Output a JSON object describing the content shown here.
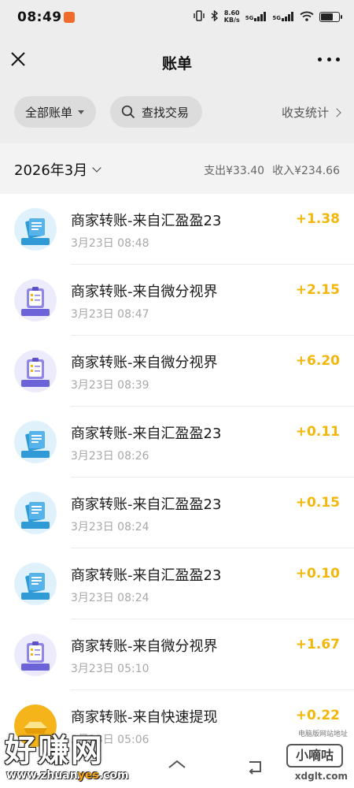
{
  "status_bar": {
    "time": "08:49",
    "net_speed_value": "8.60",
    "net_speed_unit": "KB/s",
    "sim1": "5G",
    "sim2": "5G"
  },
  "header": {
    "title": "账单"
  },
  "filters": {
    "all_bills": "全部账单",
    "search": "查找交易",
    "stats": "收支统计"
  },
  "month_summary": {
    "month": "2026年3月",
    "expense": "支出¥33.40",
    "income": "收入¥234.66"
  },
  "transactions": [
    {
      "title": "商家转账-来自汇盈盈23",
      "time": "3月23日 08:48",
      "amount": "+1.38",
      "icon": "ledger-book-icon"
    },
    {
      "title": "商家转账-来自微分视界",
      "time": "3月23日 08:47",
      "amount": "+2.15",
      "icon": "clipboard-icon"
    },
    {
      "title": "商家转账-来自微分视界",
      "time": "3月23日 08:39",
      "amount": "+6.20",
      "icon": "clipboard-icon"
    },
    {
      "title": "商家转账-来自汇盈盈23",
      "time": "3月23日 08:26",
      "amount": "+0.11",
      "icon": "ledger-book-icon"
    },
    {
      "title": "商家转账-来自汇盈盈23",
      "time": "3月23日 08:24",
      "amount": "+0.15",
      "icon": "ledger-book-icon"
    },
    {
      "title": "商家转账-来自汇盈盈23",
      "time": "3月23日 08:24",
      "amount": "+0.10",
      "icon": "ledger-book-icon"
    },
    {
      "title": "商家转账-来自微分视界",
      "time": "3月23日 05:10",
      "amount": "+1.67",
      "icon": "clipboard-icon"
    },
    {
      "title": "商家转账-来自快速提现",
      "time": "3月23日 05:06",
      "amount": "+0.22",
      "icon": "gold-ingot-icon"
    }
  ],
  "watermark": {
    "left_text": "好赚网",
    "left_url_a": "www.zhuan",
    "left_url_b": "yes",
    "left_url_c": ".com",
    "right_tag": "电脑版网站地址",
    "right_brand": "小嘀咕",
    "right_site": "xdglt.com"
  },
  "colors": {
    "amount": "#f2b70a",
    "header_bg": "#ededed"
  }
}
